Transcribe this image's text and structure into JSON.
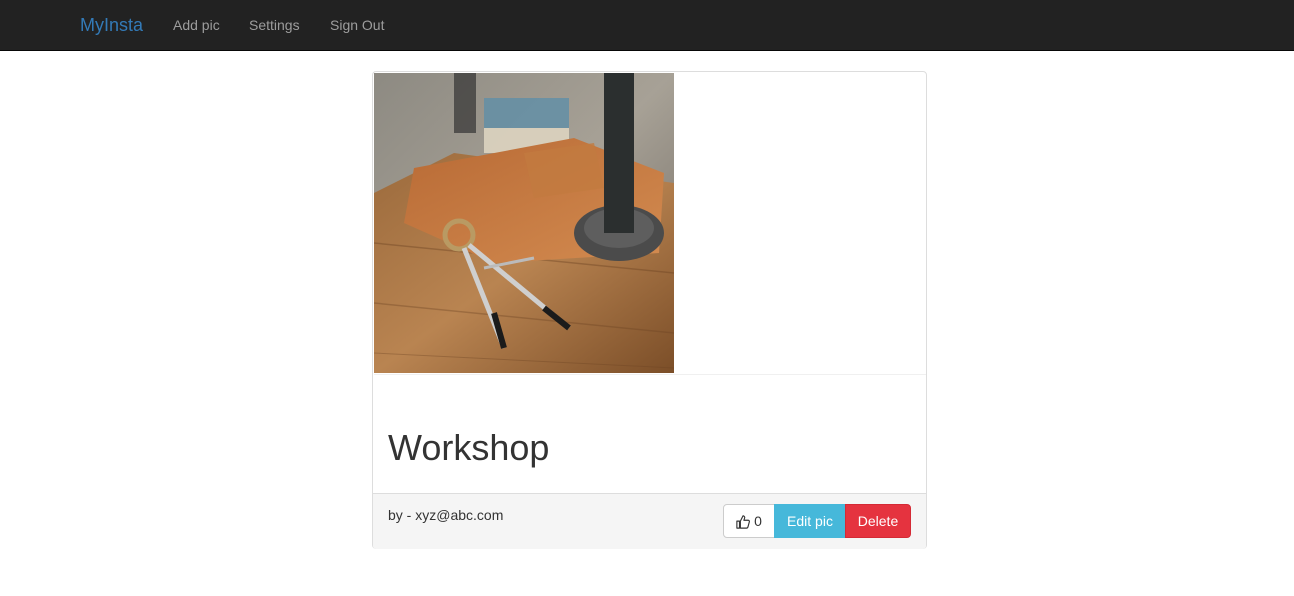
{
  "navbar": {
    "brand": "MyInsta",
    "links": [
      "Add pic",
      "Settings",
      "Sign Out"
    ]
  },
  "post": {
    "title": "Workshop",
    "author_line": "by - xyz@abc.com",
    "likes": "0",
    "image_icon": "workshop-photo",
    "actions": {
      "like_icon": "thumbs-up-icon",
      "edit_label": "Edit pic",
      "delete_label": "Delete"
    }
  },
  "colors": {
    "navbar_bg": "#222222",
    "brand": "#337ab7",
    "edit_button": "#46b8da",
    "delete_button": "#e5333f"
  }
}
